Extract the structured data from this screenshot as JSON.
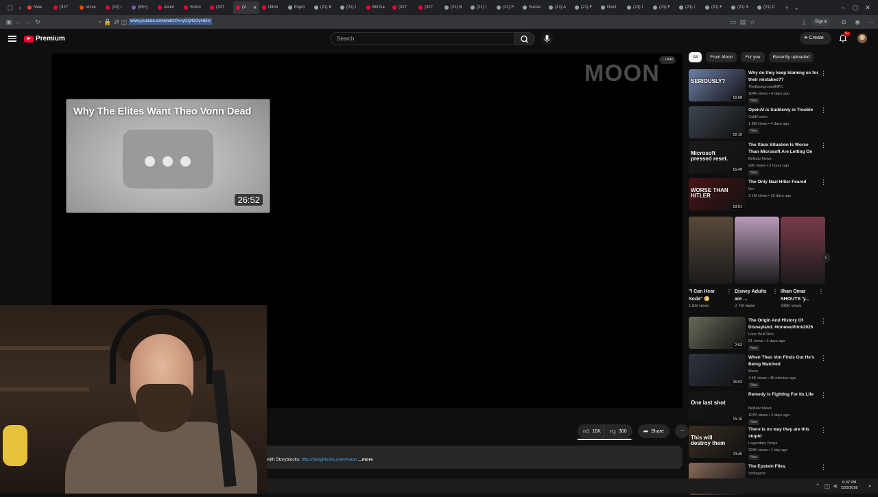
{
  "browser": {
    "tabs": [
      {
        "label": "New",
        "color": "#ea4335"
      },
      {
        "label": "(327",
        "color": "#ff0033"
      },
      {
        "label": "r/Live",
        "color": "#ff4500"
      },
      {
        "label": "(20) I",
        "color": "#ff0033"
      },
      {
        "label": "(99+)",
        "color": "#7e57c2"
      },
      {
        "label": "Asmo",
        "color": "#ff0033"
      },
      {
        "label": "Schro",
        "color": "#ff0033"
      },
      {
        "label": "(327",
        "color": "#ff0033"
      },
      {
        "label": "(2",
        "color": "#ff0033"
      },
      {
        "label": "Ultrm",
        "color": "#ff0033"
      },
      {
        "label": "Explo",
        "color": "#9aa0a6"
      },
      {
        "label": "(21) B",
        "color": "#9aa0a6"
      },
      {
        "label": "(21) I",
        "color": "#9aa0a6"
      },
      {
        "label": "Bill Ga",
        "color": "#ff0033"
      },
      {
        "label": "(327",
        "color": "#ff0033"
      },
      {
        "label": "(327",
        "color": "#ff0033"
      },
      {
        "label": "(21) B",
        "color": "#9aa0a6"
      },
      {
        "label": "(21) I",
        "color": "#9aa0a6"
      },
      {
        "label": "(21) F",
        "color": "#9aa0a6"
      },
      {
        "label": "Succe",
        "color": "#9aa0a6"
      },
      {
        "label": "(21) A",
        "color": "#9aa0a6"
      },
      {
        "label": "(21) F",
        "color": "#9aa0a6"
      },
      {
        "label": "Discl",
        "color": "#9aa0a6"
      },
      {
        "label": "(21) I",
        "color": "#9aa0a6"
      },
      {
        "label": "(21) F",
        "color": "#9aa0a6"
      },
      {
        "label": "(21) I",
        "color": "#9aa0a6"
      },
      {
        "label": "(21) F",
        "color": "#9aa0a6"
      },
      {
        "label": "(21) S",
        "color": "#9aa0a6"
      },
      {
        "label": "(21) C",
        "color": "#9aa0a6"
      }
    ],
    "active_tab_index": 8,
    "new_tab": "+",
    "url": "www.youtube.com/watch?v=yGQ42Oy4d5U",
    "signin": "Sign in"
  },
  "youtube": {
    "brand": "Premium",
    "search_placeholder": "Search",
    "create_label": "Create",
    "notif_count": "9+"
  },
  "player": {
    "channel_watermark": "MOON",
    "hide_label": "Hide",
    "endcard": {
      "title": "Why The Elites Want Theo Vonn Dead",
      "duration": "26:52"
    },
    "likes": "16K",
    "dislikes": "300",
    "share_label": "Share",
    "like_fraction": 0.98,
    "description_prefix": "with Storyblocks: ",
    "description_link": "http://storyblocks.com/moon",
    "description_more": " ...more"
  },
  "sidebar": {
    "chips": [
      "All",
      "From Moon",
      "For you",
      "Recently uploaded"
    ],
    "recs_top": [
      {
        "title": "Why do they keep blaming us for their mistakes??",
        "channel": "TheBackgroundNPC",
        "stats": "184K views • 4 days ago",
        "badge": "New",
        "duration": "16:08",
        "thumb_text": "SERIOUSLY?",
        "bg": "#6f7fa8"
      },
      {
        "title": "OpenAI is Suddenly in Trouble",
        "channel": "ColdFusion",
        "stats": "1.8M views • 4 days ago",
        "badge": "New",
        "duration": "22:10",
        "thumb_text": "",
        "bg": "#3c4650"
      },
      {
        "title": "The Xbox Situation Is Worse Than Microsoft Are Letting On",
        "channel": "Bellular News",
        "stats": "29K views • 3 hours ago",
        "badge": "New",
        "duration": "15:49",
        "thumb_text": "Microsoft pressed reset.",
        "bg": "#1a1a1a"
      },
      {
        "title": "The Only Nazi Hitler Feared",
        "channel": "Ikm",
        "stats": "2.1M views • 10 days ago",
        "badge": "",
        "duration": "18:51",
        "thumb_text": "WORSE THAN HITLER",
        "bg": "#4a1414"
      }
    ],
    "shorts": [
      {
        "title": "\"I Can Hear Soda\" 😳",
        "views": "1.8M views",
        "bg": "#5a4a3a"
      },
      {
        "title": "Disney Adults are ...",
        "views": "2.7M views",
        "bg": "#b89ab8"
      },
      {
        "title": "Ilhan Omar SHOUTS 'y...",
        "views": "339K views",
        "bg": "#7a3a4a"
      }
    ],
    "recs_bottom": [
      {
        "title": "The Origin And History Of Disneyland. #lonewulfrick2026",
        "channel": "Lone Wulf Rick",
        "stats": "81 views • 3 days ago",
        "badge": "New",
        "duration": "2:53",
        "thumb_text": "",
        "bg": "#6a6a5a"
      },
      {
        "title": "When Theo Von Finds Out He's Being Watched",
        "channel": "Moon",
        "stats": "4.5K views • 46 minutes ago",
        "badge": "New",
        "duration": "26:52",
        "thumb_text": "",
        "bg": "#2e3440"
      },
      {
        "title": "Remedy Is Fighting For Its Life",
        "channel": "Bellular News",
        "stats": "107K views • 2 days ago",
        "badge": "New",
        "duration": "15:16",
        "thumb_text": "One last shot",
        "bg": "#141414"
      },
      {
        "title": "There is no way they are this stupid",
        "channel": "Legendary Drops",
        "stats": "293K views • 1 day ago",
        "badge": "New",
        "duration": "23:45",
        "thumb_text": "This will destroy them",
        "bg": "#3a3020"
      },
      {
        "title": "The Epstein Files.",
        "channel": "Volksgeist",
        "stats": "",
        "badge": "",
        "duration": "",
        "thumb_text": "",
        "bg": "#8a6a5a"
      }
    ]
  },
  "system": {
    "time": "6:02 PM",
    "date": "2/25/2026"
  }
}
